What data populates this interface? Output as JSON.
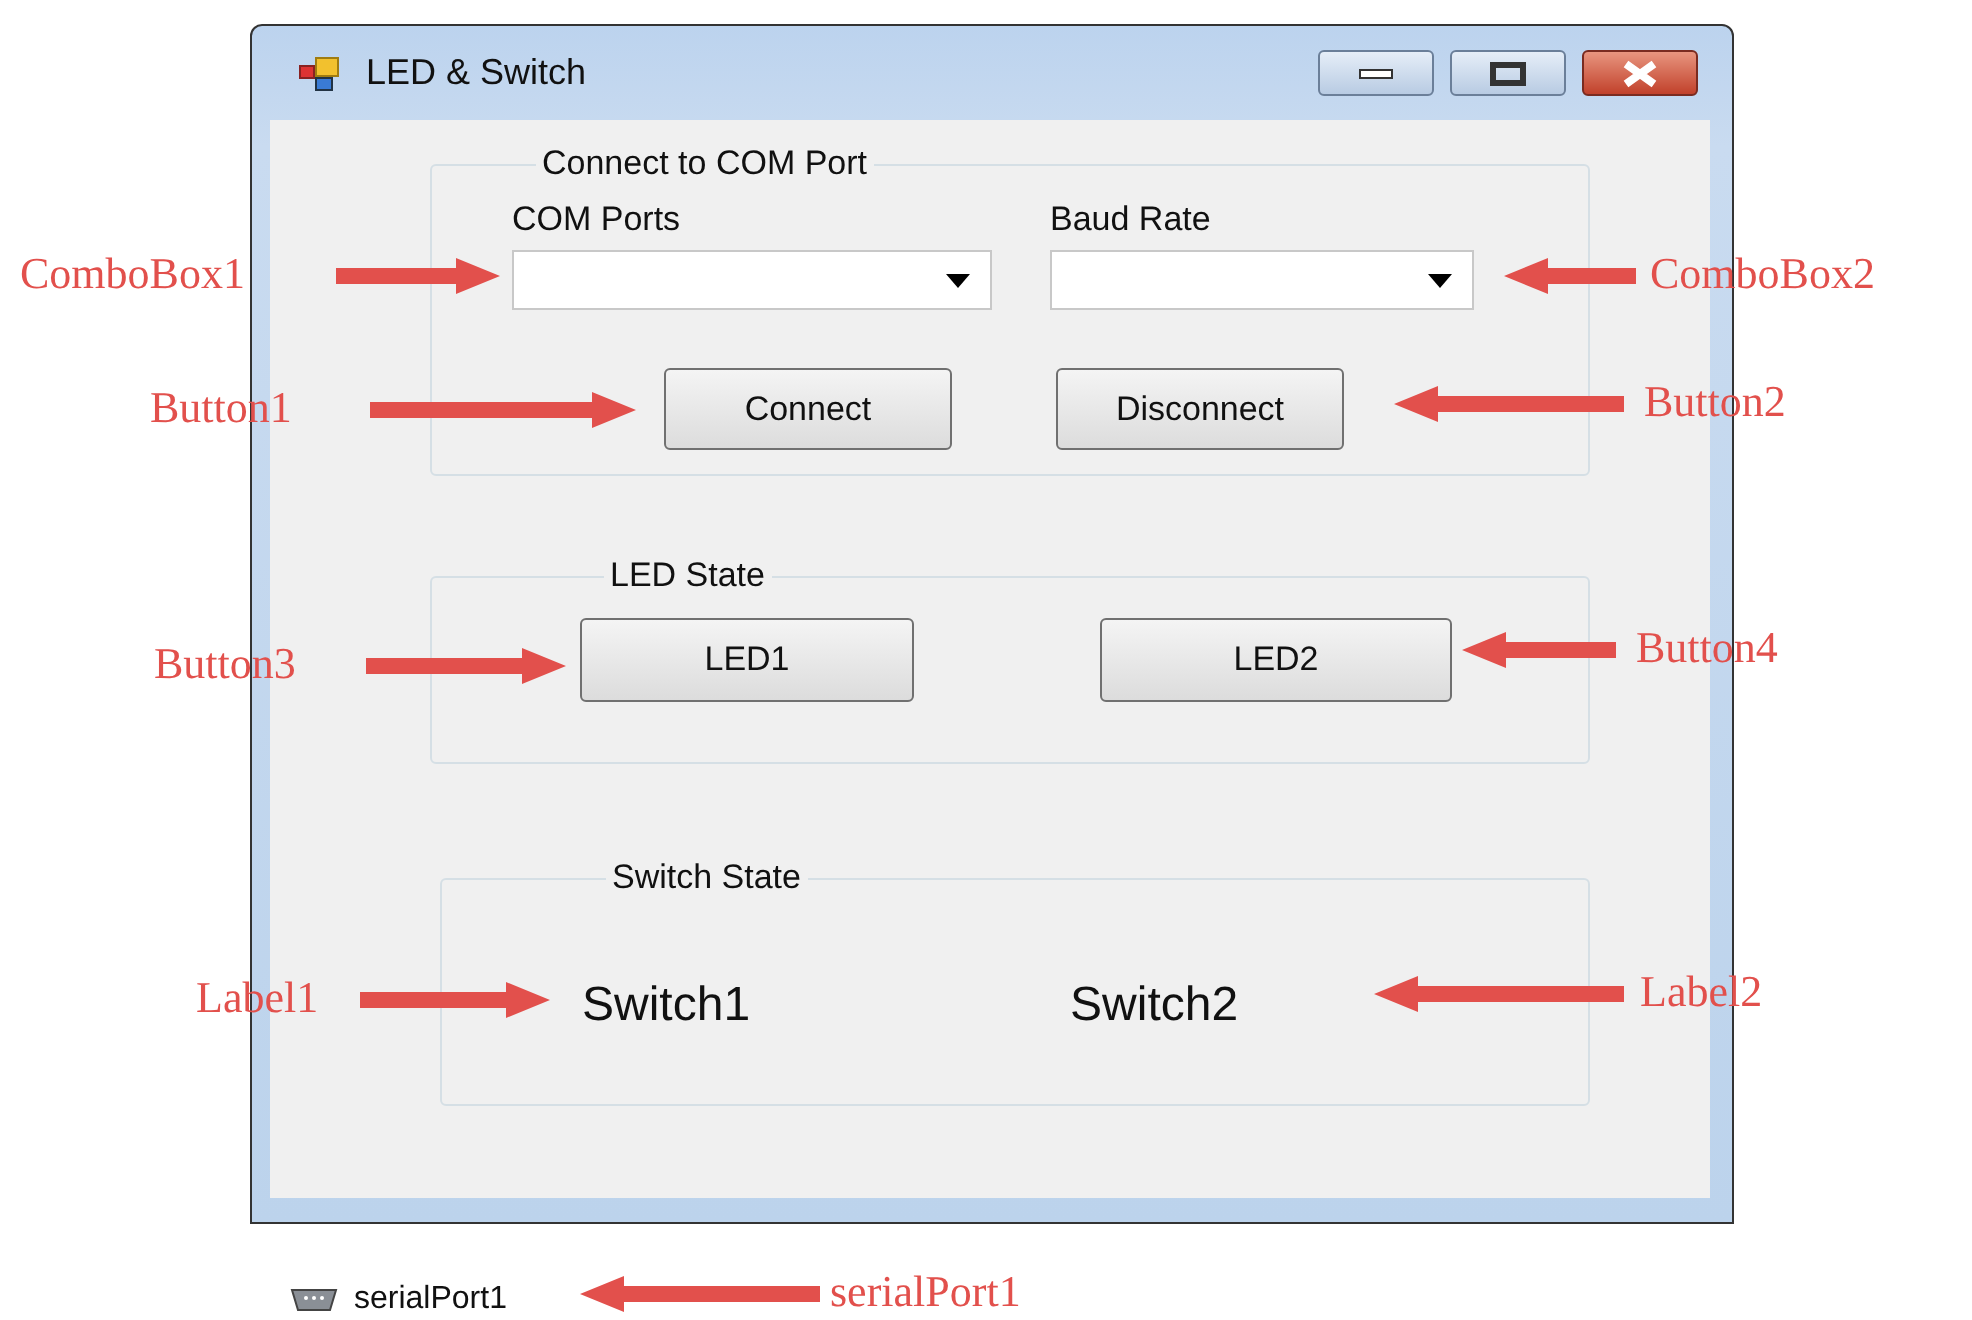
{
  "window": {
    "title": "LED & Switch"
  },
  "groups": [
    {
      "title": "Connect to COM Port",
      "fields": [
        {
          "label": "COM Ports"
        },
        {
          "label": "Baud Rate"
        }
      ],
      "buttons": [
        "Connect",
        "Disconnect"
      ]
    },
    {
      "title": "LED State",
      "buttons": [
        "LED1",
        "LED2"
      ]
    },
    {
      "title": "Switch State",
      "labels": [
        "Switch1",
        "Switch2"
      ]
    }
  ],
  "component_tray": [
    "serialPort1"
  ],
  "annotations": [
    {
      "text": "ComboBox1",
      "points_right": true
    },
    {
      "text": "ComboBox2",
      "points_right": false
    },
    {
      "text": "Button1",
      "points_right": true
    },
    {
      "text": "Button2",
      "points_right": false
    },
    {
      "text": "Button3",
      "points_right": true
    },
    {
      "text": "Button4",
      "points_right": false
    },
    {
      "text": "Label1",
      "points_right": true
    },
    {
      "text": "Label2",
      "points_right": false
    },
    {
      "text": "serialPort1",
      "points_right": false
    }
  ]
}
